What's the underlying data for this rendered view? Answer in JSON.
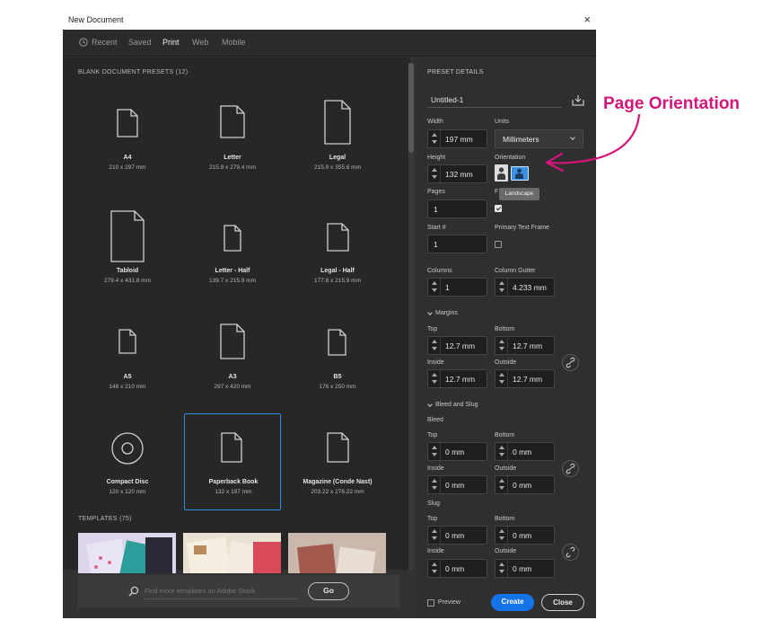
{
  "window": {
    "title": "New Document",
    "close_glyph": "×"
  },
  "tabs": [
    {
      "label": "Recent",
      "icon": "clock-icon",
      "active": false
    },
    {
      "label": "Saved",
      "active": false
    },
    {
      "label": "Print",
      "active": true
    },
    {
      "label": "Web",
      "active": false
    },
    {
      "label": "Mobile",
      "active": false
    }
  ],
  "presets_section": {
    "title": "BLANK DOCUMENT PRESETS",
    "count": "(12)"
  },
  "presets": [
    {
      "name": "A4",
      "dims": "210 x 297 mm"
    },
    {
      "name": "Letter",
      "dims": "215.9 x 279.4 mm"
    },
    {
      "name": "Legal",
      "dims": "215.9 x 355.6 mm"
    },
    {
      "name": "Tabloid",
      "dims": "279.4 x 431.8 mm"
    },
    {
      "name": "Letter - Half",
      "dims": "139.7 x 215.9 mm"
    },
    {
      "name": "Legal - Half",
      "dims": "177.8 x 215.9 mm"
    },
    {
      "name": "A5",
      "dims": "148 x 210 mm"
    },
    {
      "name": "A3",
      "dims": "297 x 420 mm"
    },
    {
      "name": "B5",
      "dims": "176 x 250 mm"
    },
    {
      "name": "Compact Disc",
      "dims": "120 x 120 mm"
    },
    {
      "name": "Paperback Book",
      "dims": "132 x 197 mm",
      "selected": true
    },
    {
      "name": "Magazine (Conde Nast)",
      "dims": "203.22 x 276.22 mm"
    }
  ],
  "templates_section": {
    "title": "TEMPLATES",
    "count": "(75)"
  },
  "stock": {
    "placeholder": "Find more templates on Adobe Stock",
    "go_label": "Go"
  },
  "details": {
    "title": "PRESET DETAILS",
    "doc_name": "Untitled-1",
    "width_label": "Width",
    "width_value": "197 mm",
    "units_label": "Units",
    "units_value": "Millimeters",
    "height_label": "Height",
    "height_value": "132 mm",
    "orientation_label": "Orientation",
    "orientation_tooltip": "Landscape",
    "orientation_selected": "landscape",
    "pages_label": "Pages",
    "pages_value": "1",
    "facing_label": "F",
    "facing_checked": true,
    "start_label": "Start #",
    "start_value": "1",
    "primary_frame_label": "Primary Text Frame",
    "primary_frame_checked": false,
    "columns_label": "Columns",
    "columns_value": "1",
    "gutter_label": "Column Gutter",
    "gutter_value": "4.233 mm"
  },
  "margins": {
    "title": "Margins",
    "top_label": "Top",
    "top_value": "12.7 mm",
    "bottom_label": "Bottom",
    "bottom_value": "12.7 mm",
    "inside_label": "Inside",
    "inside_value": "12.7 mm",
    "outside_label": "Outside",
    "outside_value": "12.7 mm"
  },
  "bleed_slug": {
    "title": "Bleed and Slug",
    "bleed_label": "Bleed",
    "bleed": {
      "top_label": "Top",
      "top": "0 mm",
      "bottom_label": "Bottom",
      "bottom": "0 mm",
      "inside_label": "Inside",
      "inside": "0 mm",
      "outside_label": "Outside",
      "outside": "0 mm"
    },
    "slug_label": "Slug",
    "slug": {
      "top_label": "Top",
      "top": "0 mm",
      "bottom_label": "Bottom",
      "bottom": "0 mm",
      "inside_label": "Inside",
      "inside": "0 mm",
      "outside_label": "Outside",
      "outside": "0 mm"
    }
  },
  "footer": {
    "preview_label": "Preview",
    "preview_checked": false,
    "create_label": "Create",
    "close_label": "Close"
  },
  "annotation": {
    "text": "Page Orientation",
    "color": "#d4157a"
  },
  "colors": {
    "accent": "#2d8ceb",
    "panel": "#323232",
    "dark": "#272727"
  }
}
